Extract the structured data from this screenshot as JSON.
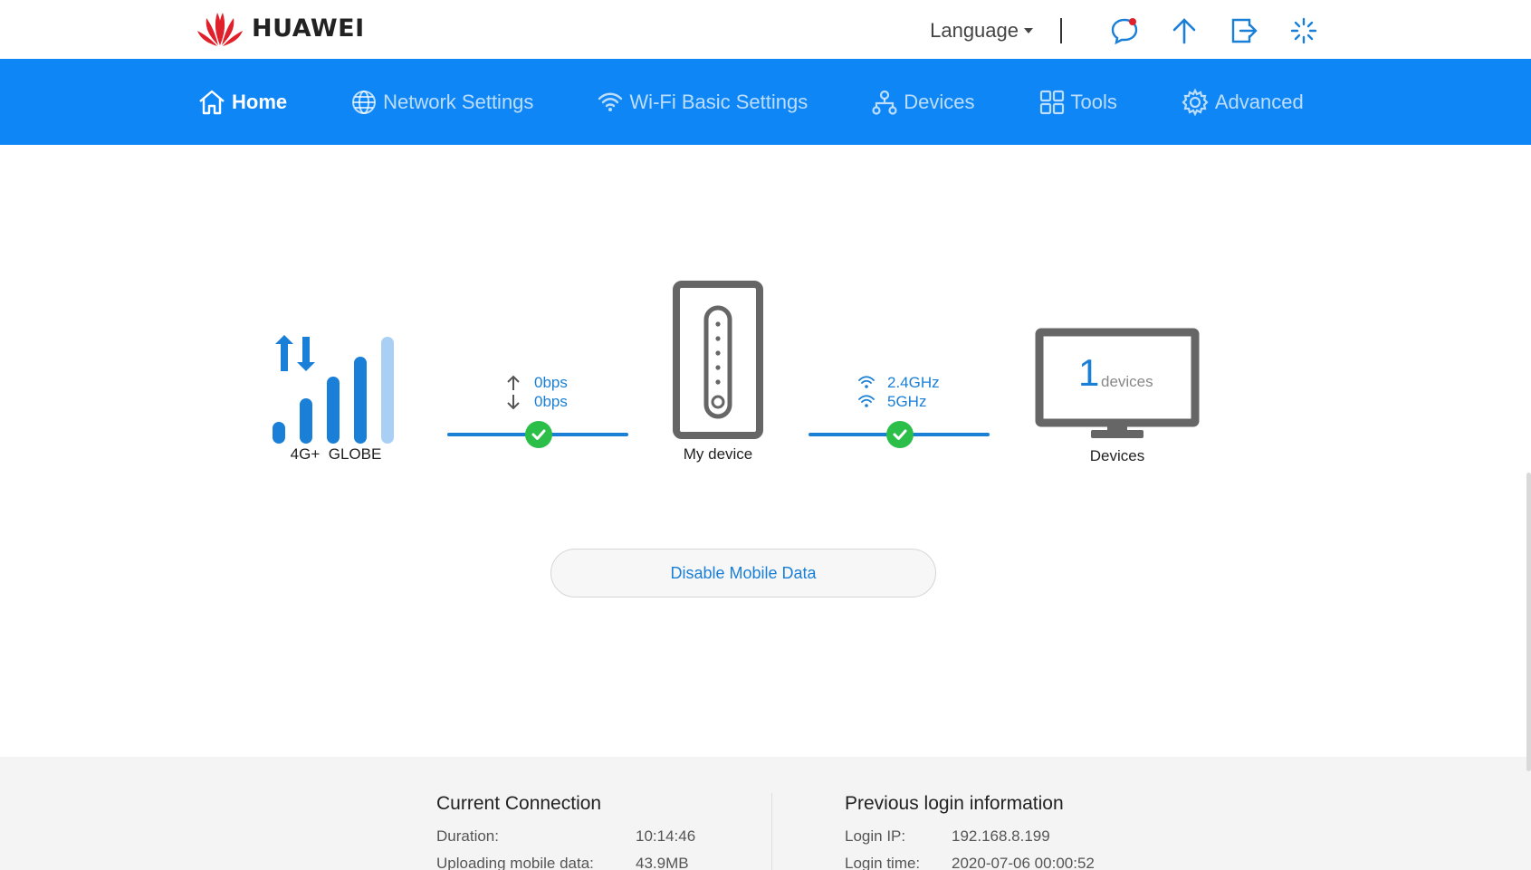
{
  "header": {
    "brand": "HUAWEI",
    "language_label": "Language",
    "icons": [
      "message-icon",
      "upload-icon",
      "logout-icon",
      "loading-icon"
    ]
  },
  "nav": {
    "items": [
      {
        "label": "Home",
        "icon": "home-icon",
        "active": true
      },
      {
        "label": "Network Settings",
        "icon": "globe-icon"
      },
      {
        "label": "Wi-Fi Basic Settings",
        "icon": "wifi-icon"
      },
      {
        "label": "Devices",
        "icon": "devices-icon"
      },
      {
        "label": "Tools",
        "icon": "tools-icon"
      },
      {
        "label": "Advanced",
        "icon": "gear-icon"
      }
    ]
  },
  "status": {
    "network_label": "4G+  GLOBE",
    "upload_speed": "0bps",
    "download_speed": "0bps",
    "device_label": "My device",
    "band_24": "2.4GHz",
    "band_5": "5GHz",
    "device_count": "1",
    "device_count_unit": "devices",
    "devices_label": "Devices"
  },
  "actions": {
    "disable_mobile_data": "Disable Mobile Data"
  },
  "current_connection": {
    "title": "Current Connection",
    "duration_label": "Duration:",
    "duration_value": "10:14:46",
    "upload_label": "Uploading mobile data:",
    "upload_value": "43.9MB"
  },
  "previous_login": {
    "title": "Previous login information",
    "ip_label": "Login IP:",
    "ip_value": "192.168.8.199",
    "time_label": "Login time:",
    "time_value": "2020-07-06 00:00:52"
  },
  "colors": {
    "nav_bg": "#0f86f5",
    "accent": "#1a7fd6",
    "ok": "#2bbf4a",
    "brand_red": "#e0202a"
  }
}
